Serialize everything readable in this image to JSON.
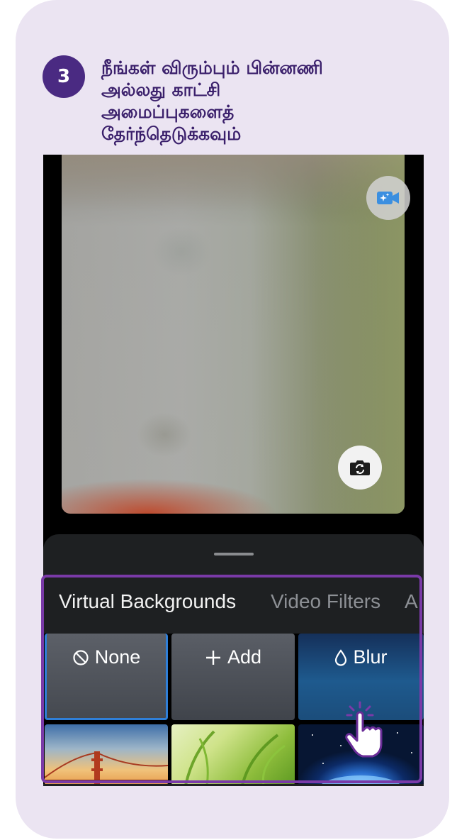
{
  "step": {
    "number": "3",
    "instruction_lines": [
      "நீங்கள் விரும்பும் பின்னணி",
      "அல்லது காட்சி",
      "அமைப்புகளைத்",
      "தேர்ந்தெடுக்கவும்"
    ]
  },
  "preview": {
    "video_effects_icon": "video-sparkle-icon",
    "switch_camera_icon": "camera-switch-icon"
  },
  "tabs": [
    {
      "label": "Virtual Backgrounds",
      "active": true
    },
    {
      "label": "Video Filters",
      "active": false
    },
    {
      "label": "A",
      "active": false
    }
  ],
  "tiles": {
    "none": {
      "label": "None",
      "icon": "none-circle-slash-icon",
      "selected": true
    },
    "add": {
      "label": "Add",
      "icon": "plus-icon"
    },
    "blur": {
      "label": "Blur",
      "icon": "droplet-icon"
    },
    "images": [
      "golden-gate-bridge",
      "green-grass",
      "space-earth"
    ]
  },
  "colors": {
    "card_background": "#ebe4f2",
    "badge": "#4a2a82",
    "instruction_text": "#3a1f6b",
    "highlight_border": "#7a3aa8",
    "selected_tile_border": "#2f7fd8"
  }
}
